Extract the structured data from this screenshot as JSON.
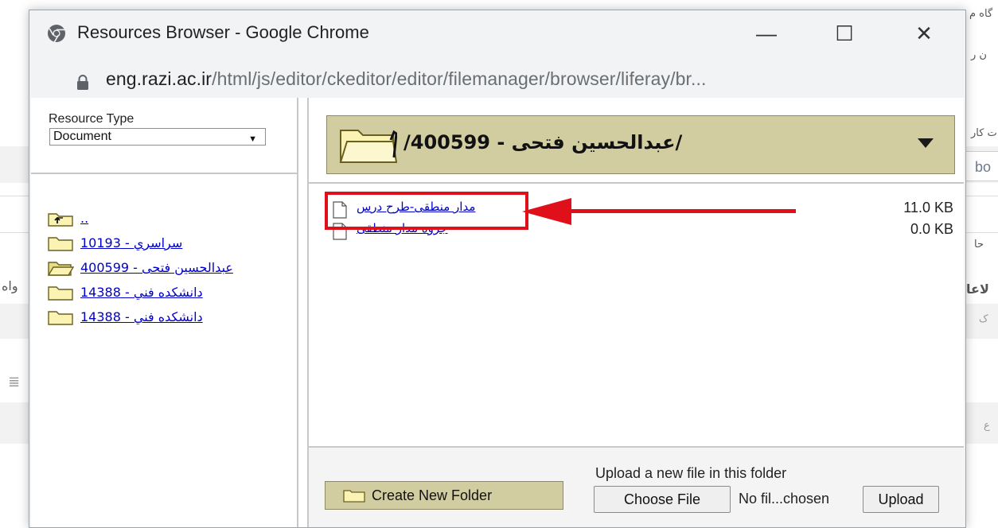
{
  "background_page": {
    "fragments": [
      "گاه م",
      "ن ر",
      "ت کار",
      "bo",
      "حا",
      "لاعا",
      "واه",
      "ک",
      "ع"
    ]
  },
  "window": {
    "title": "Resources Browser - Google Chrome",
    "controls": {
      "minimize": "—",
      "maximize": "☐",
      "close": "✕"
    }
  },
  "address_bar": {
    "host": "eng.razi.ac.ir",
    "path": "/html/js/editor/ckeditor/editor/filemanager/browser/liferay/br..."
  },
  "left_pane": {
    "resource_type_label": "Resource Type",
    "resource_type_value": "Document",
    "tree": [
      {
        "label": "..",
        "icon": "folder-up-icon"
      },
      {
        "label": "سراسري - 10193",
        "icon": "folder-icon"
      },
      {
        "label": "عبدالحسین فتحی - 400599",
        "icon": "folder-open-icon"
      },
      {
        "label": "دانشكده فني - 14388",
        "icon": "folder-icon"
      },
      {
        "label": "دانشكده فني - 14388",
        "icon": "folder-icon"
      }
    ]
  },
  "right_pane": {
    "current_folder": "/عبدالحسین فتحی - 400599/",
    "files": [
      {
        "name": "مدار منطقی-طرح درس",
        "size": "11.0 KB"
      },
      {
        "name": "جزوه مدار منطقی",
        "size": "0.0 KB"
      }
    ]
  },
  "footer": {
    "create_folder_label": "Create New Folder",
    "upload_label": "Upload a new file in this folder",
    "choose_file_label": "Choose File",
    "no_file_text": "No fil...chosen",
    "upload_button_label": "Upload"
  },
  "colors": {
    "folder_bar": "#d2cda0",
    "link": "#0000cc",
    "annotation_red": "#e0101a"
  }
}
